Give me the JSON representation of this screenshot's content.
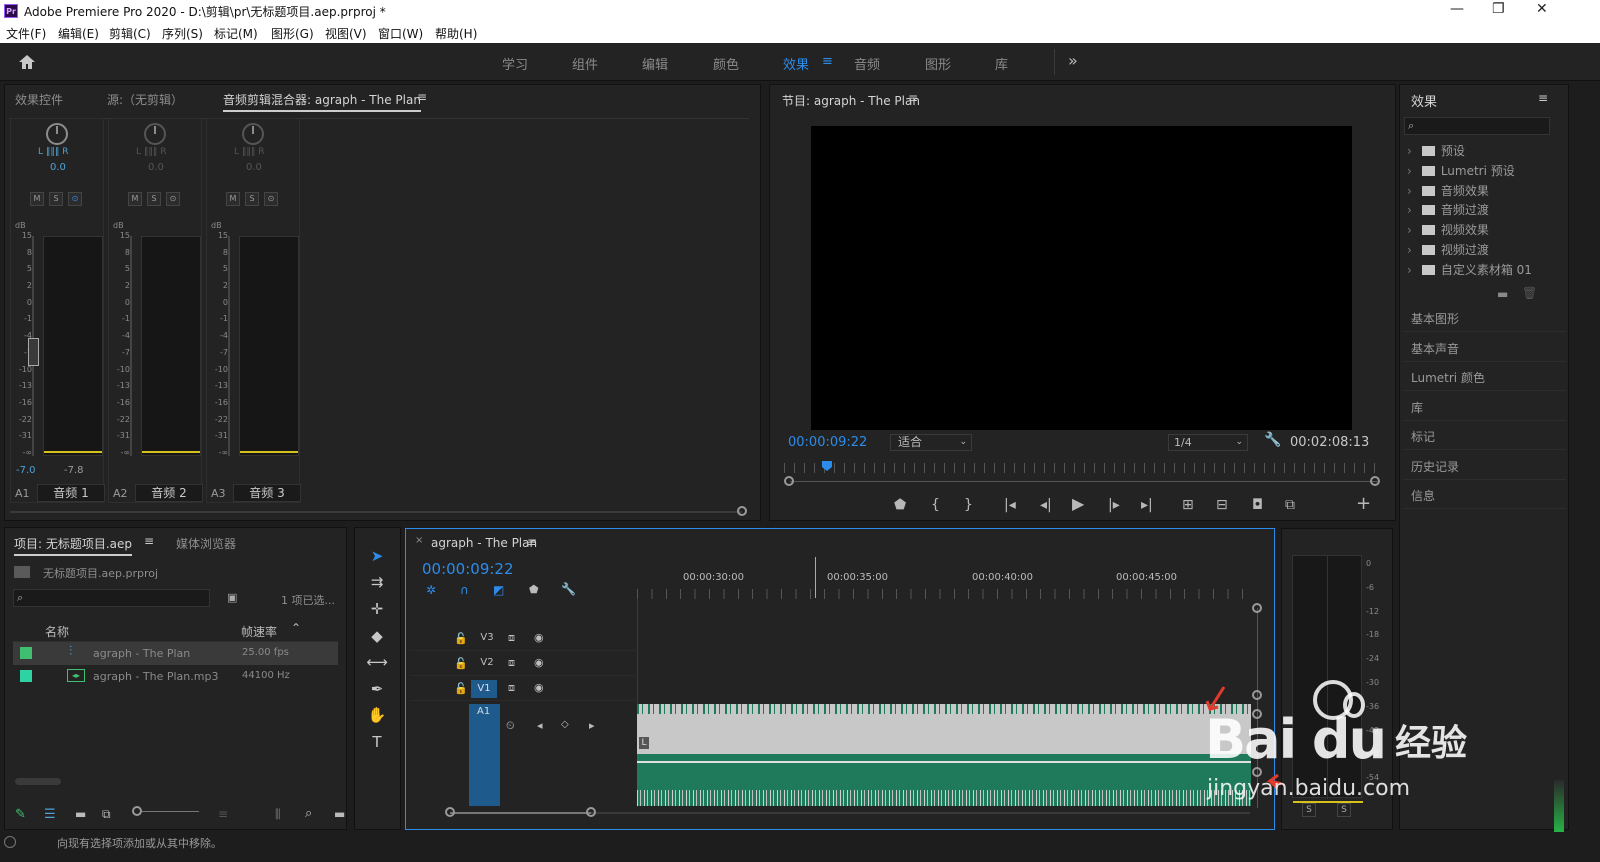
{
  "window": {
    "title": "Adobe Premiere Pro 2020 - D:\\剪辑\\pr\\无标题项目.aep.prproj *",
    "logo": "Pr",
    "minimize": "—",
    "maximize": "❐",
    "close": "✕"
  },
  "menu": [
    "文件(F)",
    "编辑(E)",
    "剪辑(C)",
    "序列(S)",
    "标记(M)",
    "图形(G)",
    "视图(V)",
    "窗口(W)",
    "帮助(H)"
  ],
  "workspaces": [
    "学习",
    "组件",
    "编辑",
    "颜色",
    "效果",
    "音频",
    "图形",
    "库"
  ],
  "workspace_active": "效果",
  "workspace_more": "»",
  "source_panel": {
    "tabs": [
      "效果控件",
      "源:（无剪辑）",
      "音频剪辑混合器: agraph - The Plan"
    ],
    "channels": [
      {
        "lr_l": "L",
        "lr_r": "R",
        "pan": "0.0",
        "m": "M",
        "s": "S",
        "r": "⊙",
        "val_left": "-7.0",
        "val_right": "-7.8",
        "track": "A1",
        "name": "音频 1"
      },
      {
        "lr_l": "L",
        "lr_r": "R",
        "pan": "0.0",
        "m": "M",
        "s": "S",
        "r": "⊙",
        "val_left": "",
        "val_right": "",
        "track": "A2",
        "name": "音频 2"
      },
      {
        "lr_l": "L",
        "lr_r": "R",
        "pan": "0.0",
        "m": "M",
        "s": "S",
        "r": "⊙",
        "val_left": "",
        "val_right": "",
        "track": "A3",
        "name": "音频 3"
      }
    ],
    "db_label": "dB",
    "db_scale": [
      "15",
      "8",
      "5",
      "2",
      "0",
      "-1",
      "-4",
      "-7",
      "-10",
      "-13",
      "-16",
      "-22",
      "-31",
      "-∞"
    ]
  },
  "program": {
    "title": "节目: agraph - The Plan",
    "timecode": "00:00:09:22",
    "fit": "适合",
    "resolution": "1/4",
    "duration": "00:02:08:13"
  },
  "effects_panel": {
    "title": "效果",
    "items": [
      "预设",
      "Lumetri 预设",
      "音频效果",
      "音频过渡",
      "视频效果",
      "视频过渡",
      "自定义素材箱 01"
    ]
  },
  "side_panels": [
    "基本图形",
    "基本声音",
    "Lumetri 颜色",
    "库",
    "标记",
    "历史记录",
    "信息"
  ],
  "project": {
    "tabs": [
      "项目: 无标题项目.aep",
      "媒体浏览器"
    ],
    "file": "无标题项目.aep.prproj",
    "selection": "1 项已选...",
    "col_name": "名称",
    "col_fps": "帧速率",
    "rows": [
      {
        "name": "agraph - The Plan",
        "rate": "25.00 fps"
      },
      {
        "name": "agraph - The Plan.mp3",
        "rate": "44100 Hz"
      }
    ]
  },
  "timeline": {
    "tab": "agraph - The Plan",
    "timecode": "00:00:09:22",
    "ticks": [
      "00:00:30:00",
      "00:00:35:00",
      "00:00:40:00",
      "00:00:45:00"
    ],
    "tracks": [
      "V3",
      "V2",
      "V1",
      "A1"
    ],
    "clip_label": "L"
  },
  "audio_meter": {
    "scale": [
      "0",
      "-6",
      "-12",
      "-18",
      "-24",
      "-30",
      "-36",
      "-42",
      "-48",
      "-54"
    ],
    "solo": [
      "S",
      "S"
    ]
  },
  "status": "向现有选择项添加或从其中移除。",
  "watermark": {
    "brand": "Bai du",
    "cn": "经验",
    "url": "jingyan.baidu.com"
  },
  "colors": {
    "accent": "#2d8ceb",
    "clip_green": "#1f7a5c",
    "meter_yellow": "#d6c21c",
    "track_blue": "#1e5a8c"
  }
}
